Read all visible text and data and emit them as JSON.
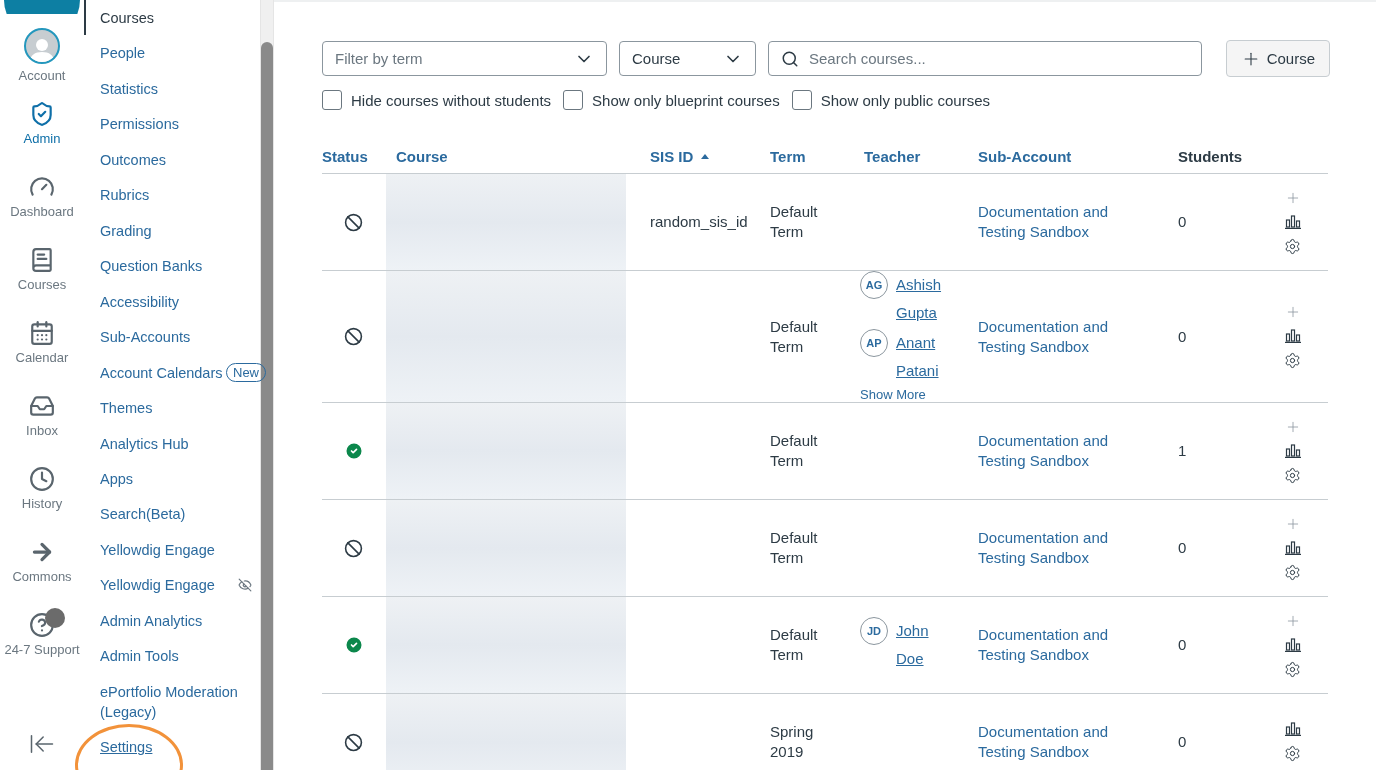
{
  "global_nav": {
    "items": [
      {
        "label": "Account",
        "selected": false
      },
      {
        "label": "Admin",
        "selected": true
      },
      {
        "label": "Dashboard",
        "selected": false
      },
      {
        "label": "Courses",
        "selected": false
      },
      {
        "label": "Calendar",
        "selected": false
      },
      {
        "label": "Inbox",
        "selected": false
      },
      {
        "label": "History",
        "selected": false
      },
      {
        "label": "Commons",
        "selected": false
      },
      {
        "label": "24-7 Support",
        "selected": false,
        "badge_dot": true
      }
    ]
  },
  "admin_menu": {
    "items": [
      {
        "label": "Courses",
        "selected": true
      },
      {
        "label": "People",
        "selected": false
      },
      {
        "label": "Statistics",
        "selected": false
      },
      {
        "label": "Permissions",
        "selected": false
      },
      {
        "label": "Outcomes",
        "selected": false
      },
      {
        "label": "Rubrics",
        "selected": false
      },
      {
        "label": "Grading",
        "selected": false
      },
      {
        "label": "Question Banks",
        "selected": false
      },
      {
        "label": "Accessibility",
        "selected": false
      },
      {
        "label": "Sub-Accounts",
        "selected": false
      },
      {
        "label": "Account Calendars",
        "selected": false,
        "badge": "New"
      },
      {
        "label": "Themes",
        "selected": false
      },
      {
        "label": "Analytics Hub",
        "selected": false
      },
      {
        "label": "Apps",
        "selected": false
      },
      {
        "label": "Search(Beta)",
        "selected": false
      },
      {
        "label": "Yellowdig Engage",
        "selected": false
      },
      {
        "label": "Yellowdig Engage",
        "selected": false,
        "hidden": true
      },
      {
        "label": "Admin Analytics",
        "selected": false
      },
      {
        "label": "Admin Tools",
        "selected": false
      },
      {
        "label": "ePortfolio Moderation (Legacy)",
        "selected": false
      },
      {
        "label": "Settings",
        "selected": false,
        "highlighted": true
      }
    ]
  },
  "filters": {
    "term": {
      "placeholder": "Filter by term"
    },
    "type": {
      "value": "Course"
    },
    "search": {
      "placeholder": "Search courses..."
    },
    "add_button": "Course",
    "checkboxes": [
      {
        "label": "Hide courses without students",
        "checked": false
      },
      {
        "label": "Show only blueprint courses",
        "checked": false
      },
      {
        "label": "Show only public courses",
        "checked": false
      }
    ]
  },
  "table": {
    "columns": [
      {
        "label": "Status",
        "sortable": true,
        "sorted": false
      },
      {
        "label": "Course",
        "sortable": true,
        "sorted": false
      },
      {
        "label": "SIS ID",
        "sortable": true,
        "sorted": true
      },
      {
        "label": "Term",
        "sortable": true,
        "sorted": false
      },
      {
        "label": "Teacher",
        "sortable": true,
        "sorted": false
      },
      {
        "label": "Sub-Account",
        "sortable": true,
        "sorted": false
      },
      {
        "label": "Students",
        "sortable": false,
        "sorted": false
      }
    ],
    "rows": [
      {
        "published": false,
        "sis_id": "random_sis_id",
        "term": "Default Term",
        "teachers": [],
        "sub_account": "Documentation and Testing Sandbox",
        "students": "0",
        "can_add": true
      },
      {
        "published": false,
        "term": "Default Term",
        "teachers": [
          {
            "initials": "AG",
            "name": "Ashish Gupta"
          },
          {
            "initials": "AP",
            "name": "Anant Patani"
          }
        ],
        "show_more": "Show More",
        "sub_account": "Documentation and Testing Sandbox",
        "students": "0",
        "can_add": true
      },
      {
        "published": true,
        "term": "Default Term",
        "teachers": [],
        "sub_account": "Documentation and Testing Sandbox",
        "students": "1",
        "can_add": true
      },
      {
        "published": false,
        "term": "Default Term",
        "teachers": [],
        "sub_account": "Documentation and Testing Sandbox",
        "students": "0",
        "can_add": true
      },
      {
        "published": true,
        "term": "Default Term",
        "teachers": [
          {
            "initials": "JD",
            "name": "John Doe"
          }
        ],
        "sub_account": "Documentation and Testing Sandbox",
        "students": "0",
        "can_add": true
      },
      {
        "published": false,
        "term": "Spring 2019",
        "teachers": [],
        "sub_account": "Documentation and Testing Sandbox",
        "students": "0",
        "can_add": false
      }
    ]
  }
}
